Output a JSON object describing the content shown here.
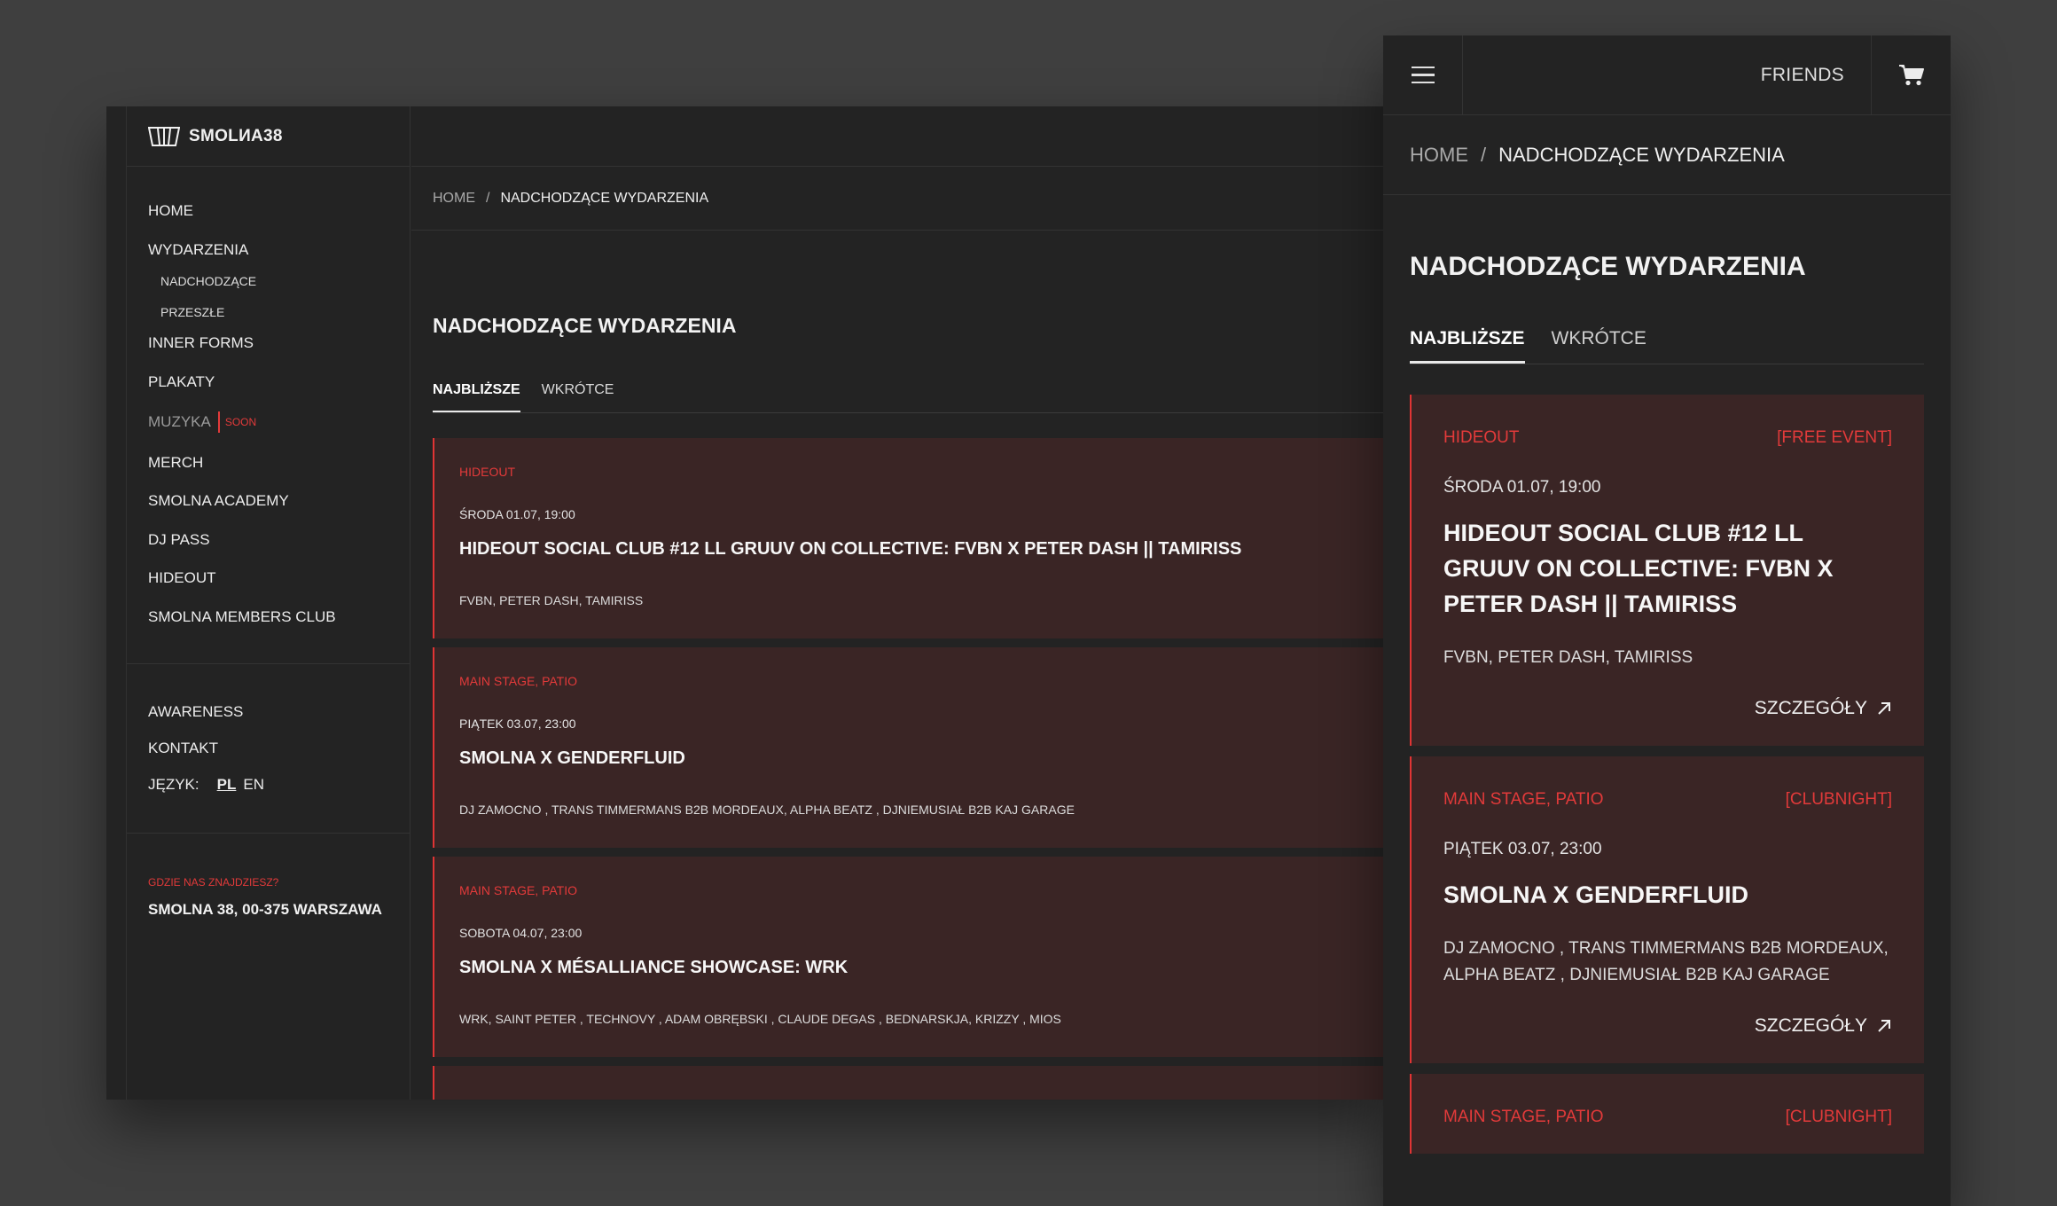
{
  "desktop": {
    "logo_text": "SMOLИA38",
    "nav": [
      {
        "label": "HOME"
      },
      {
        "label": "WYDARZENIA"
      },
      {
        "label": "NADCHODZĄCE",
        "sub": true
      },
      {
        "label": "PRZESZŁE",
        "sub": true
      },
      {
        "label": "INNER FORMS"
      },
      {
        "label": "PLAKATY"
      },
      {
        "label": "MUZYKA",
        "badge": "SOON"
      },
      {
        "label": "MERCH"
      },
      {
        "label": "SMOLNA ACADEMY"
      },
      {
        "label": "DJ PASS"
      },
      {
        "label": "HIDEOUT"
      },
      {
        "label": "SMOLNA MEMBERS CLUB"
      }
    ],
    "nav_secondary": {
      "awareness": "AWARENESS",
      "kontakt": "KONTAKT",
      "lang_label": "JĘZYK:",
      "lang_pl": "PL",
      "lang_en": "EN"
    },
    "location": {
      "label": "GDZIE NAS ZNAJDZIESZ?",
      "address": "SMOLNA 38, 00-375 WARSZAWA"
    },
    "breadcrumb": {
      "home": "HOME",
      "sep": "/",
      "current": "NADCHODZĄCE WYDARZENIA"
    },
    "title": "NADCHODZĄCE WYDARZENIA",
    "tabs": {
      "najblizsze": "NAJBLIŻSZE",
      "wkrotce": "WKRÓTCE"
    },
    "events": [
      {
        "venue": "HIDEOUT",
        "date": "ŚRODA 01.07, 19:00",
        "title": "HIDEOUT SOCIAL CLUB #12 LL GRUUV ON COLLECTIVE: FVBN X PETER DASH || TAMIRISS",
        "artists": "FVBN, PETER DASH, TAMIRISS"
      },
      {
        "venue": "MAIN STAGE, PATIO",
        "date": "PIĄTEK 03.07, 23:00",
        "title": "SMOLNA X GENDERFLUID",
        "artists": "DJ ZAMOCNO , TRANS TIMMERMANS B2B MORDEAUX, ALPHA BEATZ , DJNIEMUSIAŁ B2B KAJ GARAGE"
      },
      {
        "venue": "MAIN STAGE, PATIO",
        "date": "SOBOTA 04.07, 23:00",
        "title": "SMOLNA X MÉSALLIANCE SHOWCASE: WRK",
        "artists": "WRK, SAINT PETER , TECHNOVY , ADAM OBRĘBSKI , CLAUDE DEGAS , BEDNARSKJA, KRIZZY , MIOS"
      }
    ]
  },
  "mobile": {
    "friends": "FRIENDS",
    "breadcrumb": {
      "home": "HOME",
      "sep": "/",
      "current": "NADCHODZĄCE WYDARZENIA"
    },
    "title": "NADCHODZĄCE WYDARZENIA",
    "tabs": {
      "najblizsze": "NAJBLIŻSZE",
      "wkrotce": "WKRÓTCE"
    },
    "more_label": "SZCZEGÓŁY",
    "events": [
      {
        "venue": "HIDEOUT",
        "tag": "[FREE EVENT]",
        "date": "ŚRODA 01.07, 19:00",
        "title": "HIDEOUT SOCIAL CLUB #12 LL GRUUV ON COLLECTIVE: FVBN X PETER DASH || TAMIRISS",
        "artists": "FVBN, PETER DASH, TAMIRISS"
      },
      {
        "venue": "MAIN STAGE, PATIO",
        "tag": "[CLUBNIGHT]",
        "date": "PIĄTEK 03.07, 23:00",
        "title": "SMOLNA X GENDERFLUID",
        "artists": "DJ ZAMOCNO , TRANS TIMMERMANS B2B MORDEAUX, ALPHA BEATZ , DJNIEMUSIAŁ B2B KAJ GARAGE"
      },
      {
        "venue": "MAIN STAGE, PATIO",
        "tag": "[CLUBNIGHT]"
      }
    ]
  },
  "colors": {
    "accent": "#e23a3a",
    "card_bg": "#3a2525",
    "page_bg": "#232323",
    "backdrop": "#3f3f3f"
  },
  "icons": {
    "logo": "speaker-grille-logo-icon",
    "menu": "hamburger-menu-icon",
    "cart": "shopping-cart-icon",
    "arrow": "arrow-up-right-icon"
  }
}
